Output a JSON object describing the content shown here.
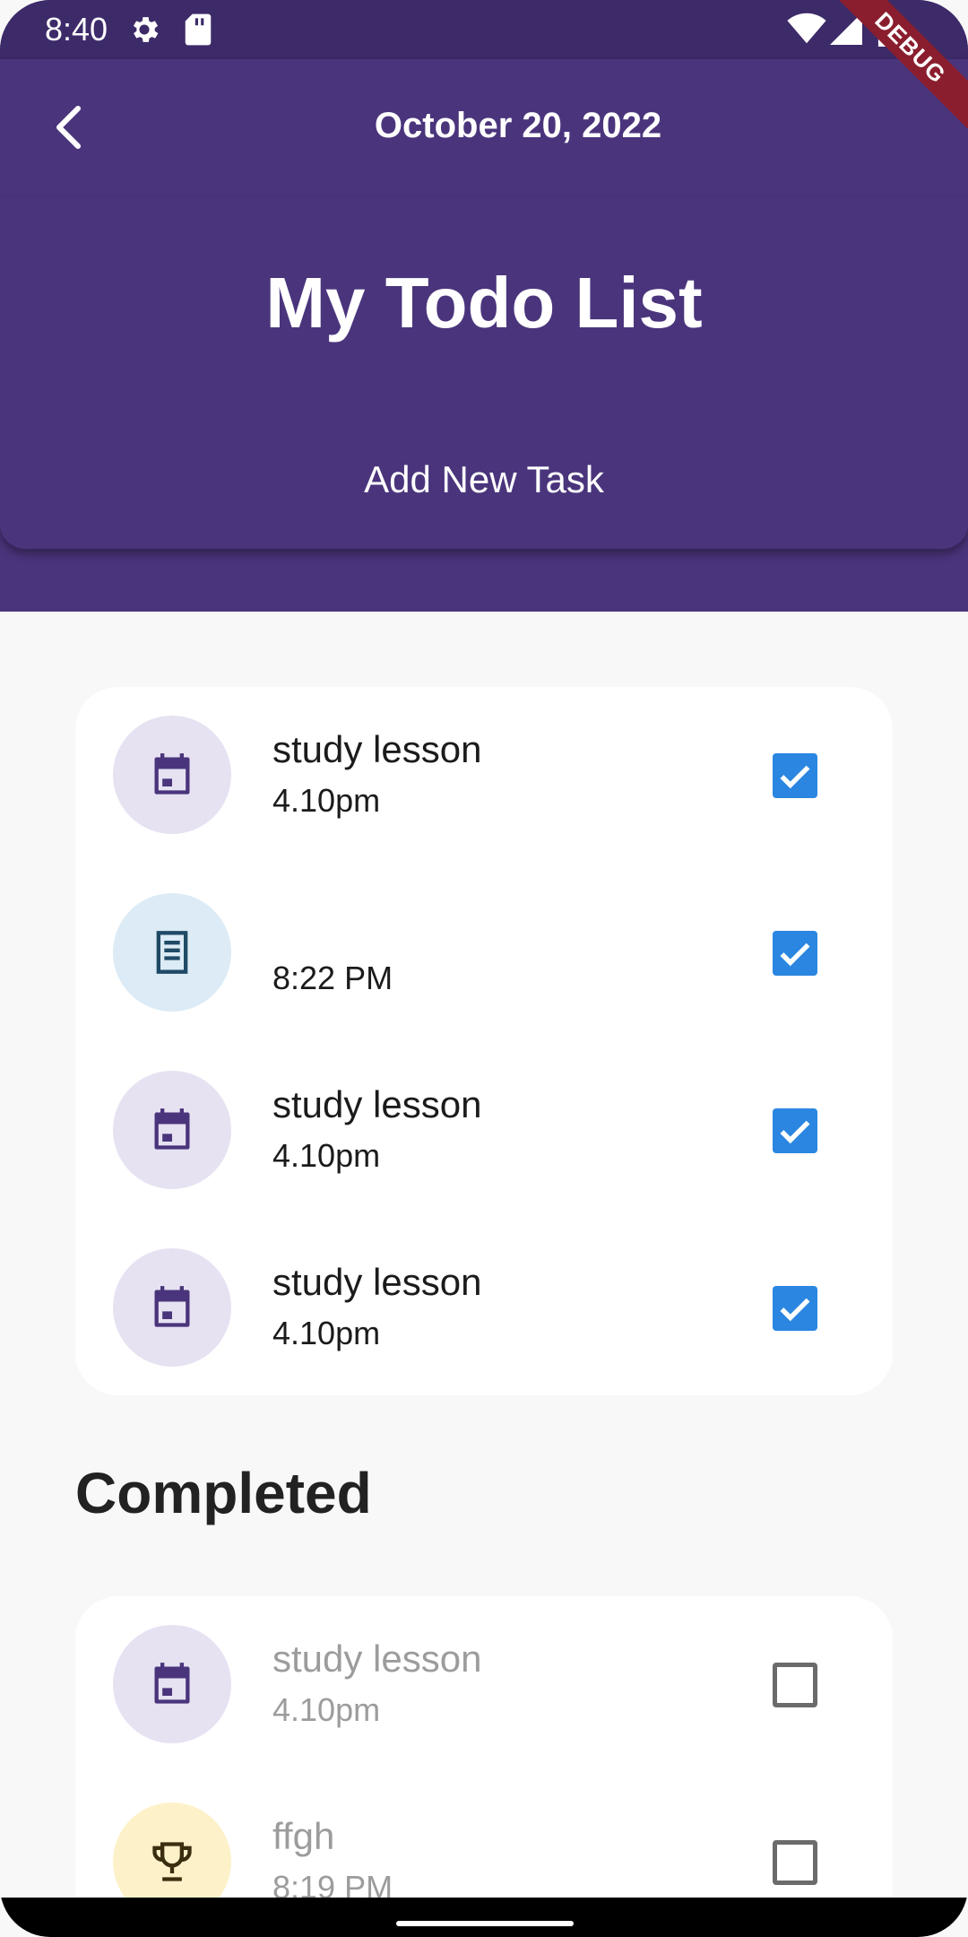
{
  "status_bar": {
    "time": "8:40"
  },
  "app_bar": {
    "date": "October 20, 2022",
    "debug_label": "DEBUG"
  },
  "header": {
    "title": "My Todo List",
    "add_task_label": "Add New Task"
  },
  "tasks": [
    {
      "title": "study lesson",
      "time": "4.10pm",
      "icon": "calendar-icon",
      "checked": true
    },
    {
      "title": "",
      "time": "8:22 PM",
      "icon": "notes-icon",
      "checked": true
    },
    {
      "title": "study lesson",
      "time": "4.10pm",
      "icon": "calendar-icon",
      "checked": true
    },
    {
      "title": "study lesson",
      "time": "4.10pm",
      "icon": "calendar-icon",
      "checked": true
    }
  ],
  "completed_section": {
    "title": "Completed",
    "items": [
      {
        "title": "study lesson",
        "time": "4.10pm",
        "icon": "calendar-icon",
        "checked": false
      },
      {
        "title": "ffgh",
        "time": "8:19 PM",
        "icon": "trophy-icon",
        "checked": false
      }
    ]
  },
  "colors": {
    "primary": "#4a357c",
    "checkbox_checked": "#2a86e0",
    "icon_purple": "#4a357c"
  }
}
